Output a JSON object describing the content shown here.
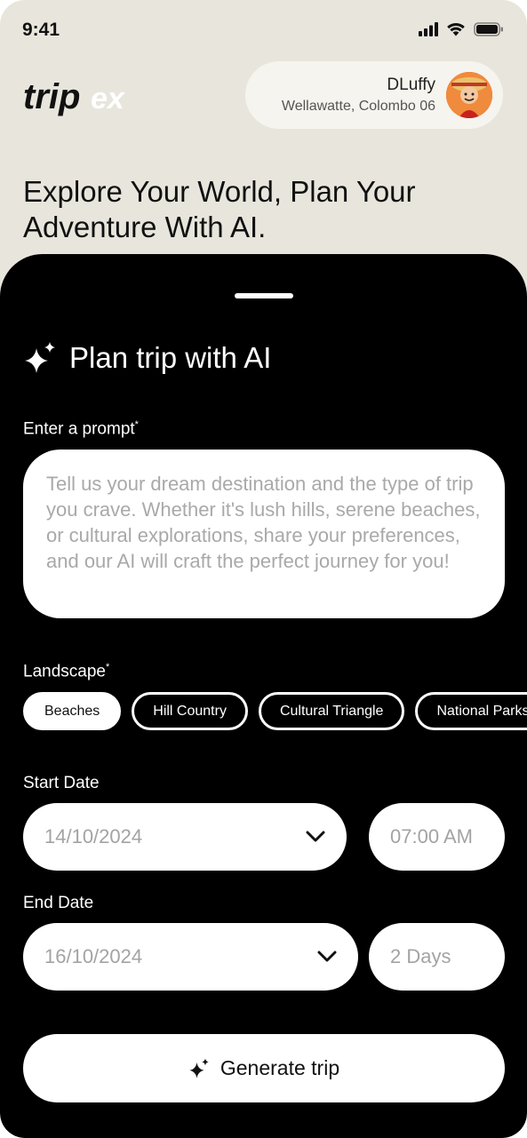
{
  "status_bar": {
    "time": "9:41",
    "icons": [
      "cellular-signal-icon",
      "wifi-icon",
      "battery-icon"
    ]
  },
  "header": {
    "logo_text_trip": "trip",
    "logo_text_ex": "ex",
    "user_name": "DLuffy",
    "user_location": "Wellawatte, Colombo 06"
  },
  "headline": "Explore Your World, Plan Your Adventure With AI.",
  "sheet": {
    "title": "Plan trip with AI",
    "title_icon": "sparkles-icon",
    "prompt_label": "Enter a prompt",
    "prompt_required": "*",
    "prompt_placeholder": "Tell us your dream destination and the type of trip you crave. Whether it's lush hills, serene beaches, or cultural explorations, share your preferences, and our AI will craft the perfect journey for you!",
    "landscape_label": "Landscape",
    "landscape_required": "*",
    "landscapes": [
      {
        "label": "Beaches",
        "selected": true
      },
      {
        "label": "Hill Country",
        "selected": false
      },
      {
        "label": "Cultural Triangle",
        "selected": false
      },
      {
        "label": "National Parks",
        "selected": false
      }
    ],
    "start_date_label": "Start Date",
    "start_date": "14/10/2024",
    "start_time": "07:00 AM",
    "end_date_label": "End Date",
    "end_date": "16/10/2024",
    "duration": "2 Days",
    "generate_label": "Generate trip"
  },
  "colors": {
    "background": "#e8e6dc",
    "sheet": "#000000",
    "accent": "#ffffff",
    "placeholder": "#a9a9a9"
  }
}
